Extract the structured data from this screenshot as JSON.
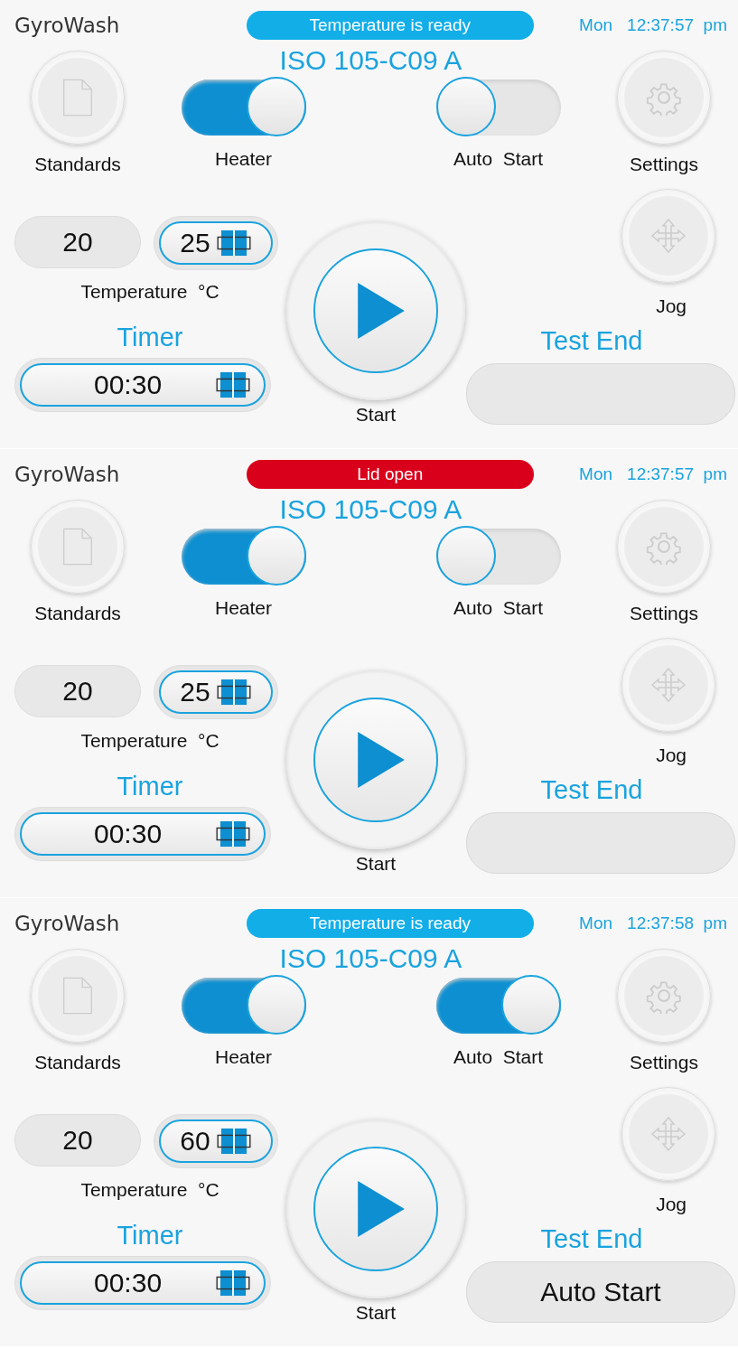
{
  "screens": [
    {
      "app_name": "GyroWash",
      "status": {
        "text": "Temperature is ready",
        "kind": "info"
      },
      "day": "Mon",
      "time": "12:37:57  pm",
      "standard": "ISO 105-C09 A",
      "standards_label": "Standards",
      "heater": {
        "label": "Heater",
        "on": true
      },
      "auto_start": {
        "label": "Auto  Start",
        "on": false
      },
      "settings_label": "Settings",
      "temp_actual": "20",
      "temp_set": "25",
      "temp_label": "Temperature  °C",
      "jog_label": "Jog",
      "timer_label": "Timer",
      "timer_value": "00:30",
      "start_label": "Start",
      "test_end_label": "Test  End"
    },
    {
      "app_name": "GyroWash",
      "status": {
        "text": "Lid open",
        "kind": "alert"
      },
      "day": "Mon",
      "time": "12:37:57  pm",
      "standard": "ISO 105-C09 A",
      "standards_label": "Standards",
      "heater": {
        "label": "Heater",
        "on": true
      },
      "auto_start": {
        "label": "Auto  Start",
        "on": false
      },
      "settings_label": "Settings",
      "temp_actual": "20",
      "temp_set": "25",
      "temp_label": "Temperature  °C",
      "jog_label": "Jog",
      "timer_label": "Timer",
      "timer_value": "00:30",
      "start_label": "Start",
      "test_end_label": "Test  End"
    },
    {
      "app_name": "GyroWash",
      "status": {
        "text": "Temperature is ready",
        "kind": "info"
      },
      "day": "Mon",
      "time": "12:37:58  pm",
      "standard": "ISO 105-C09 A",
      "standards_label": "Standards",
      "heater": {
        "label": "Heater",
        "on": true
      },
      "auto_start": {
        "label": "Auto  Start",
        "on": true
      },
      "settings_label": "Settings",
      "temp_actual": "20",
      "temp_set": "60",
      "temp_label": "Temperature  °C",
      "jog_label": "Jog",
      "timer_label": "Timer",
      "timer_value": "00:30",
      "start_label": "Start",
      "test_end_label": "Test  End",
      "test_end_value": "Auto Start"
    }
  ]
}
